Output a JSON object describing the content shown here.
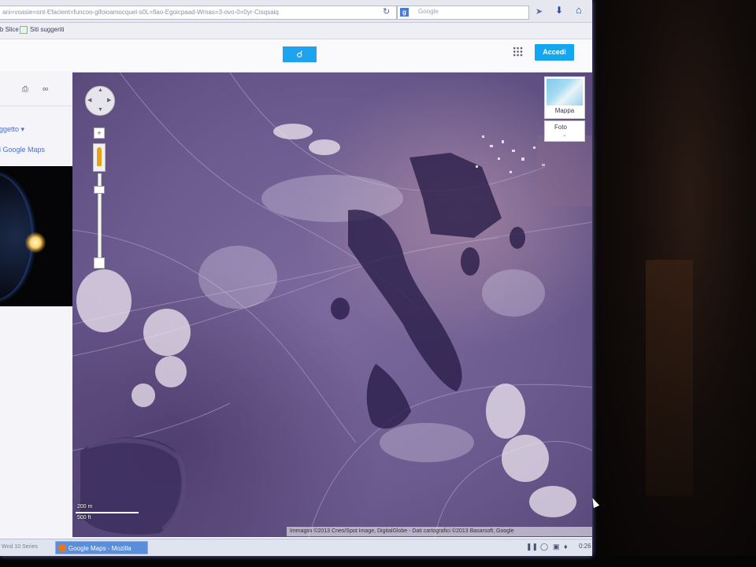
{
  "browser": {
    "url": "ani=voasie=ont-Efacient=funcoo-gifoioamocquel-s0L=fiao-Egoicpaad-Wmas=3-ovo-0=0yr-Cisqsaiq",
    "search_placeholder": "Google",
    "search_engine_badge": "g",
    "bookmarks": [
      "Web Slice",
      "Siti suggeriti"
    ]
  },
  "header": {
    "search_icon": "search-icon",
    "apps_icon": "apps-grid-icon",
    "signin_label": "Accedi"
  },
  "left_panel": {
    "icons": [
      "print-icon",
      "link-icon"
    ],
    "link_1": "oggetto",
    "link_2": "di Google Maps"
  },
  "map": {
    "type_control_label": "Mappa",
    "photo_label": "Foto",
    "scale_metric": "200 m",
    "scale_imperial": "500 ft",
    "attribution": "Immagini ©2013 Cnes/Spot Image, DigitalGlobe - Dati cartografici ©2013 Basarsoft, Google",
    "accent_color": "#14a7f0"
  },
  "taskbar": {
    "left_text": "Wnd 10 Series",
    "active_task": "Google Maps - Mozilla",
    "clock": "0:26"
  }
}
